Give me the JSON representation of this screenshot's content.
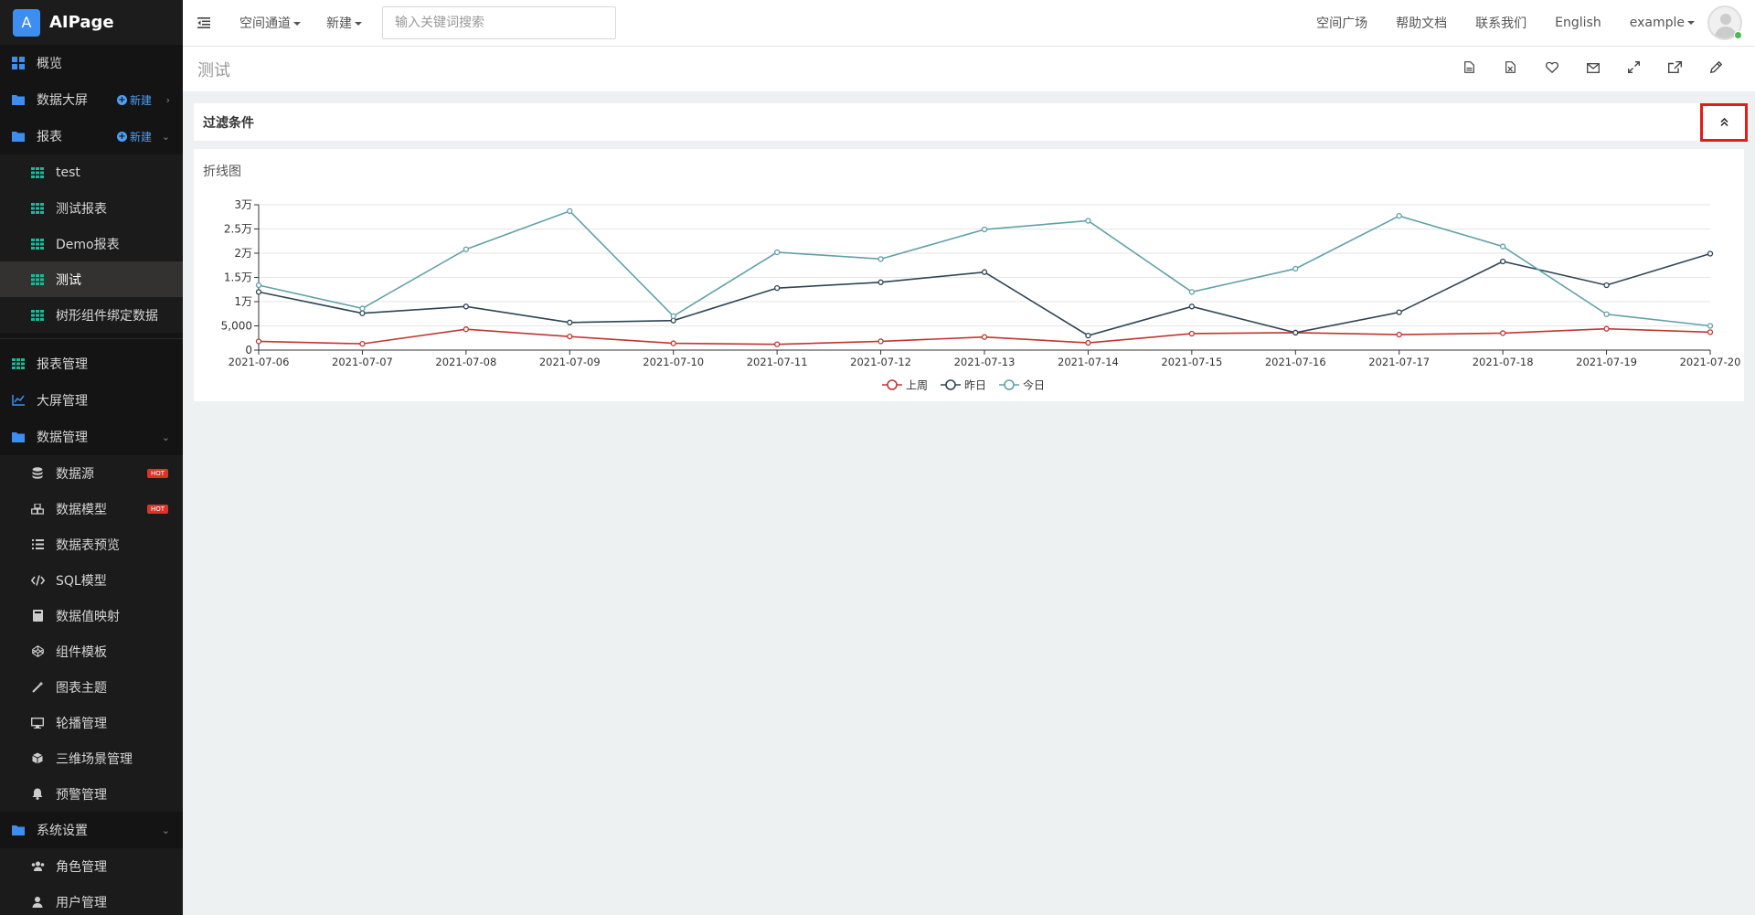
{
  "app": {
    "logo_letter": "A",
    "name": "AIPage"
  },
  "sidebar": {
    "overview": "概览",
    "dashboard": {
      "label": "数据大屏",
      "new": "新建"
    },
    "reports": {
      "label": "报表",
      "new": "新建",
      "items": [
        "test",
        "测试报表",
        "Demo报表",
        "测试",
        "树形组件绑定数据"
      ],
      "active": "测试"
    },
    "report_mgmt": "报表管理",
    "screen_mgmt": "大屏管理",
    "data_mgmt": {
      "label": "数据管理",
      "items": [
        "数据源",
        "数据模型",
        "数据表预览",
        "SQL模型",
        "数据值映射",
        "组件模板",
        "图表主题",
        "轮播管理",
        "三维场景管理",
        "预警管理"
      ],
      "hot_badge": "HOT"
    },
    "system": {
      "label": "系统设置",
      "items": [
        "角色管理",
        "用户管理"
      ]
    }
  },
  "topbar": {
    "space_channel": "空间通道",
    "new": "新建",
    "search_placeholder": "输入关键词搜索",
    "links": [
      "空间广场",
      "帮助文档",
      "联系我们",
      "English"
    ],
    "user": "example"
  },
  "page": {
    "title": "测试"
  },
  "filter": {
    "title": "过滤条件"
  },
  "chart": {
    "title": "折线图"
  },
  "colors": {
    "lastweek": "#c23531",
    "yesterday": "#2f4554",
    "today": "#61a0a8",
    "accent": "#3d8ef0",
    "highlight": "#e51b15"
  },
  "chart_data": {
    "type": "line",
    "title": "折线图",
    "x": [
      "2021-07-06",
      "2021-07-07",
      "2021-07-08",
      "2021-07-09",
      "2021-07-10",
      "2021-07-11",
      "2021-07-12",
      "2021-07-13",
      "2021-07-14",
      "2021-07-15",
      "2021-07-16",
      "2021-07-17",
      "2021-07-18",
      "2021-07-19",
      "2021-07-20"
    ],
    "ylim": [
      0,
      30000
    ],
    "yticks": [
      "0",
      "5,000",
      "1万",
      "1.5万",
      "2万",
      "2.5万",
      "3万"
    ],
    "series": [
      {
        "name": "上周",
        "color": "#c23531",
        "values": [
          1800,
          1300,
          4300,
          2800,
          1400,
          1200,
          1800,
          2700,
          1500,
          3400,
          3600,
          3200,
          3500,
          4400,
          3700
        ]
      },
      {
        "name": "昨日",
        "color": "#2f4554",
        "values": [
          12000,
          7600,
          9000,
          5700,
          6100,
          12800,
          14000,
          16100,
          3000,
          9000,
          3600,
          7800,
          18300,
          13400,
          19900
        ]
      },
      {
        "name": "今日",
        "color": "#61a0a8",
        "values": [
          13400,
          8600,
          20800,
          28700,
          7000,
          20200,
          18800,
          24900,
          26700,
          12000,
          16800,
          27700,
          21400,
          7400,
          5000
        ]
      }
    ],
    "grid": true,
    "legend": "bottom-center"
  }
}
